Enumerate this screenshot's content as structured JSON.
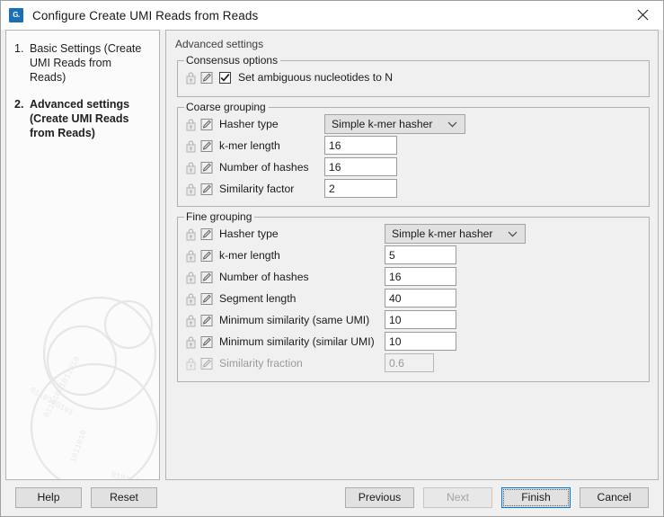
{
  "window": {
    "title": "Configure Create UMI Reads from Reads",
    "app_icon": "clc-workbench-icon",
    "icon_text": "G.",
    "close_label": "close-icon",
    "accent_color": "#0078d7",
    "title_bar_bg": "#ffffff",
    "dialog_bg": "#f0f0f0"
  },
  "steps": {
    "items": [
      {
        "number": "1.",
        "label": "Basic Settings (Create UMI Reads from Reads)",
        "active": false
      },
      {
        "number": "2.",
        "label": "Advanced settings (Create UMI Reads from Reads)",
        "active": true
      }
    ]
  },
  "content": {
    "caption": "Advanced settings",
    "groups": [
      {
        "title": "Consensus options",
        "rows": [
          {
            "type": "checkbox",
            "label": "Set ambiguous nucleotides to N",
            "checked": true,
            "locked": false,
            "editable": true,
            "disabled": false
          }
        ]
      },
      {
        "title": "Coarse grouping",
        "rows": [
          {
            "type": "combo",
            "label": "Hasher type",
            "value": "Simple k-mer hasher",
            "disabled": false
          },
          {
            "type": "text",
            "label": "k-mer length",
            "value": "16",
            "disabled": false
          },
          {
            "type": "text",
            "label": "Number of hashes",
            "value": "16",
            "disabled": false
          },
          {
            "type": "text",
            "label": "Similarity factor",
            "value": "2",
            "disabled": false
          }
        ]
      },
      {
        "title": "Fine grouping",
        "rows": [
          {
            "type": "combo",
            "label": "Hasher type",
            "value": "Simple k-mer hasher",
            "disabled": false
          },
          {
            "type": "text",
            "label": "k-mer length",
            "value": "5",
            "disabled": false
          },
          {
            "type": "text",
            "label": "Number of hashes",
            "value": "16",
            "disabled": false
          },
          {
            "type": "text",
            "label": "Segment length",
            "value": "40",
            "disabled": false
          },
          {
            "type": "text",
            "label": "Minimum similarity (same UMI)",
            "value": "10",
            "disabled": false
          },
          {
            "type": "text",
            "label": "Minimum similarity (similar UMI)",
            "value": "10",
            "disabled": false
          },
          {
            "type": "text",
            "label": "Similarity fraction",
            "value": "0.6",
            "disabled": true
          }
        ]
      }
    ]
  },
  "footer": {
    "help": "Help",
    "reset": "Reset",
    "previous": "Previous",
    "next": "Next",
    "finish": "Finish",
    "cancel": "Cancel",
    "next_disabled": true,
    "finish_default": true
  }
}
